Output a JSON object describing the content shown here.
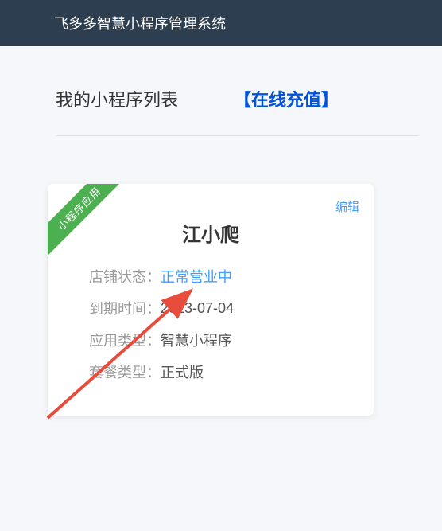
{
  "header": {
    "system_title": "飞多多智慧小程序管理系统"
  },
  "list": {
    "title": "我的小程序列表",
    "recharge_link": "【在线充值】"
  },
  "card": {
    "ribbon_label": "小程序应用",
    "edit_label": "编辑",
    "shop_name": "江小爬",
    "rows": {
      "status": {
        "label": "店铺状态：",
        "value": "正常营业中"
      },
      "expiry": {
        "label": "到期时间：",
        "value": "2023-07-04"
      },
      "app_type": {
        "label": "应用类型：",
        "value": "智慧小程序"
      },
      "package_type": {
        "label": "套餐类型：",
        "value": "正式版"
      }
    }
  },
  "colors": {
    "header_bg": "#2c3e50",
    "accent_blue": "#0052d9",
    "link_blue": "#409eff",
    "ribbon_green": "#4caf50",
    "arrow_red": "#e74c3c"
  }
}
